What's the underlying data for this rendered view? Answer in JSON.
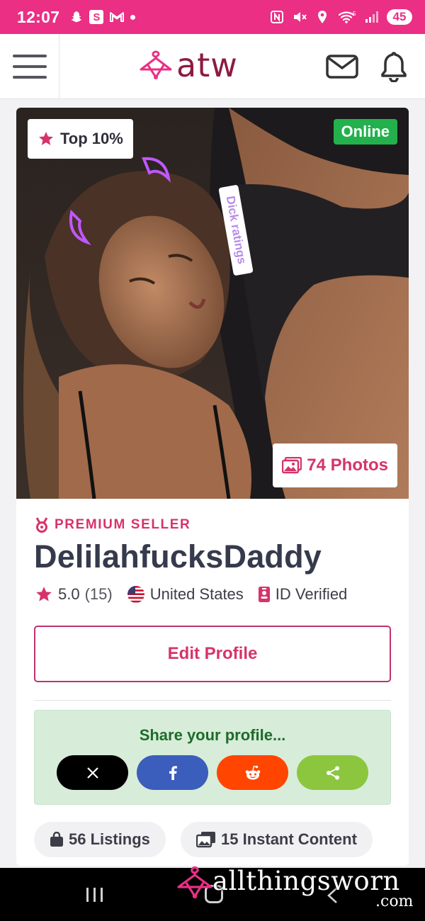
{
  "status_bar": {
    "time": "12:07",
    "s_icon": "S",
    "network": "5",
    "battery": "45"
  },
  "header": {
    "logo_text": "atw",
    "icons": [
      "menu-icon",
      "mail-icon",
      "bell-icon"
    ]
  },
  "profile": {
    "rank_badge": "Top 10%",
    "online_label": "Online",
    "sticker_text": "Dick ratings",
    "photos_label": "74 Photos",
    "seller_type": "PREMIUM SELLER",
    "username": "DelilahfucksDaddy",
    "rating": "5.0",
    "review_count": "(15)",
    "country": "United States",
    "verification": "ID Verified",
    "edit_button": "Edit Profile"
  },
  "share": {
    "title": "Share your profile...",
    "buttons": [
      {
        "icon": "x-icon",
        "glyph": "𝕏",
        "color": "#000000"
      },
      {
        "icon": "facebook-icon",
        "glyph": "f",
        "color": "#3b5dbb"
      },
      {
        "icon": "reddit-icon",
        "glyph": "reddit",
        "color": "#ff4500"
      },
      {
        "icon": "share-icon",
        "glyph": "share",
        "color": "#8cc63f"
      }
    ]
  },
  "stats": {
    "listings": "56 Listings",
    "instant_content": "15 Instant Content"
  },
  "watermark": {
    "text": "allthingsworn",
    "suffix": ".com"
  },
  "colors": {
    "brand_pink": "#ea2f85",
    "accent": "#d6336c",
    "logo": "#8d1b42",
    "online_green": "#22b14c",
    "share_bg": "#d7edd9",
    "share_title": "#1f6b2a"
  }
}
